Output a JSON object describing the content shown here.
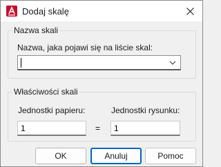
{
  "window": {
    "title": "Dodaj skalę",
    "icon": "autocad-a-icon",
    "close_icon": "close-icon"
  },
  "scale_name_group": {
    "title": "Nazwa skali",
    "field_label": "Nazwa, jaka pojawi się na liście skal:",
    "value": ""
  },
  "scale_props_group": {
    "title": "Właściwości skali",
    "paper_units_label": "Jednostki papieru:",
    "drawing_units_label": "Jednostki rysunku:",
    "paper_units_value": "1",
    "drawing_units_value": "1",
    "equals": "="
  },
  "buttons": {
    "ok": "OK",
    "cancel": "Anuluj",
    "help": "Pomoc"
  },
  "colors": {
    "accent": "#0067c0",
    "icon_red": "#c8102e"
  }
}
